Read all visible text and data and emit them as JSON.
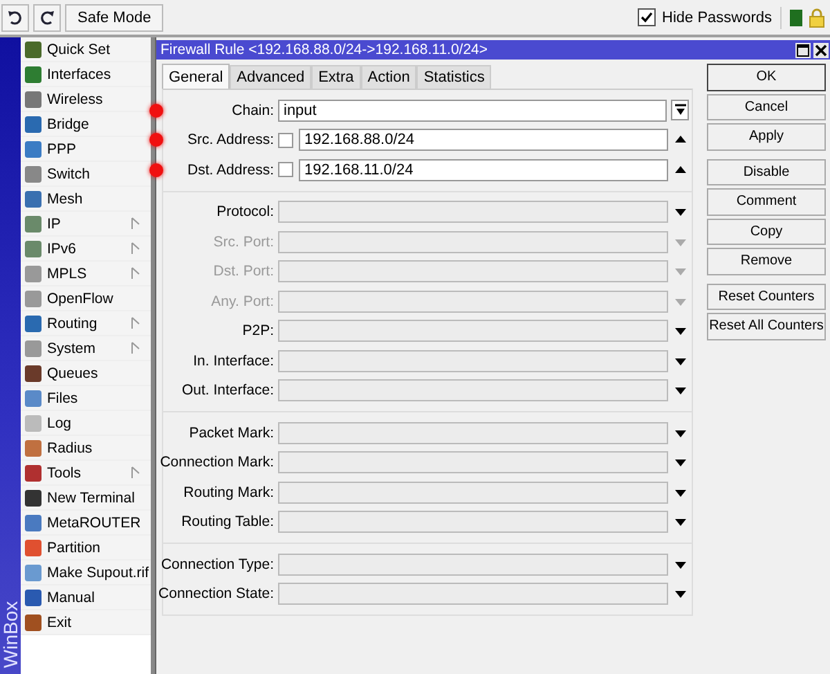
{
  "toolbar": {
    "safe_mode": "Safe Mode",
    "hide_passwords": {
      "label": "Hide Passwords",
      "checked": true
    }
  },
  "brand": "WinBox",
  "sidebar": {
    "items": [
      {
        "label": "Quick Set",
        "submenu": false
      },
      {
        "label": "Interfaces",
        "submenu": false
      },
      {
        "label": "Wireless",
        "submenu": false
      },
      {
        "label": "Bridge",
        "submenu": false
      },
      {
        "label": "PPP",
        "submenu": false
      },
      {
        "label": "Switch",
        "submenu": false
      },
      {
        "label": "Mesh",
        "submenu": false
      },
      {
        "label": "IP",
        "submenu": true
      },
      {
        "label": "IPv6",
        "submenu": true
      },
      {
        "label": "MPLS",
        "submenu": true
      },
      {
        "label": "OpenFlow",
        "submenu": false
      },
      {
        "label": "Routing",
        "submenu": true
      },
      {
        "label": "System",
        "submenu": true
      },
      {
        "label": "Queues",
        "submenu": false
      },
      {
        "label": "Files",
        "submenu": false
      },
      {
        "label": "Log",
        "submenu": false
      },
      {
        "label": "Radius",
        "submenu": false
      },
      {
        "label": "Tools",
        "submenu": true
      },
      {
        "label": "New Terminal",
        "submenu": false
      },
      {
        "label": "MetaROUTER",
        "submenu": false
      },
      {
        "label": "Partition",
        "submenu": false
      },
      {
        "label": "Make Supout.rif",
        "submenu": false
      },
      {
        "label": "Manual",
        "submenu": false
      },
      {
        "label": "Exit",
        "submenu": false
      }
    ]
  },
  "window": {
    "title": "Firewall Rule <192.168.88.0/24->192.168.11.0/24>",
    "tabs": [
      {
        "label": "General",
        "selected": true
      },
      {
        "label": "Advanced",
        "selected": false
      },
      {
        "label": "Extra",
        "selected": false
      },
      {
        "label": "Action",
        "selected": false
      },
      {
        "label": "Statistics",
        "selected": false
      }
    ],
    "groups": [
      [
        {
          "label": "Chain:",
          "kind": "combo",
          "value": "input",
          "marked": true,
          "disabled": false
        },
        {
          "label": "Src. Address:",
          "kind": "address",
          "value": "192.168.88.0/24",
          "negate": false,
          "marked": true,
          "disabled": false
        },
        {
          "label": "Dst. Address:",
          "kind": "address",
          "value": "192.168.11.0/24",
          "negate": false,
          "marked": true,
          "disabled": false
        }
      ],
      [
        {
          "label": "Protocol:",
          "kind": "select",
          "marked": false,
          "disabled": false
        },
        {
          "label": "Src. Port:",
          "kind": "select",
          "marked": false,
          "disabled": true
        },
        {
          "label": "Dst. Port:",
          "kind": "select",
          "marked": false,
          "disabled": true
        },
        {
          "label": "Any. Port:",
          "kind": "select",
          "marked": false,
          "disabled": true
        },
        {
          "label": "P2P:",
          "kind": "select",
          "marked": false,
          "disabled": false
        },
        {
          "label": "In. Interface:",
          "kind": "select",
          "marked": false,
          "disabled": false
        },
        {
          "label": "Out. Interface:",
          "kind": "select",
          "marked": false,
          "disabled": false
        }
      ],
      [
        {
          "label": "Packet Mark:",
          "kind": "select",
          "marked": false,
          "disabled": false
        },
        {
          "label": "Connection Mark:",
          "kind": "select",
          "marked": false,
          "disabled": false
        },
        {
          "label": "Routing Mark:",
          "kind": "select",
          "marked": false,
          "disabled": false
        },
        {
          "label": "Routing Table:",
          "kind": "select",
          "marked": false,
          "disabled": false
        }
      ],
      [
        {
          "label": "Connection Type:",
          "kind": "select",
          "marked": false,
          "disabled": false
        },
        {
          "label": "Connection State:",
          "kind": "select",
          "marked": false,
          "disabled": false
        }
      ]
    ],
    "button_groups": [
      [
        {
          "label": "OK",
          "default": true
        },
        {
          "label": "Cancel",
          "default": false
        },
        {
          "label": "Apply",
          "default": false
        }
      ],
      [
        {
          "label": "Disable",
          "default": false
        },
        {
          "label": "Comment",
          "default": false
        },
        {
          "label": "Copy",
          "default": false
        },
        {
          "label": "Remove",
          "default": false
        }
      ],
      [
        {
          "label": "Reset Counters",
          "default": false
        },
        {
          "label": "Reset All Counters",
          "default": false
        }
      ]
    ]
  }
}
